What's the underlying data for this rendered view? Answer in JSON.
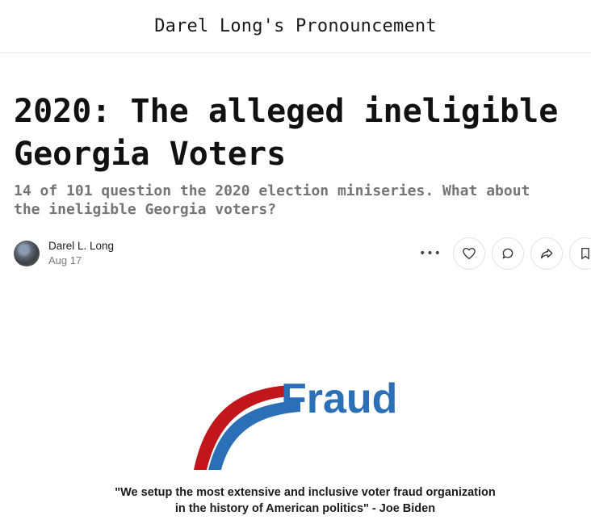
{
  "publication": {
    "title": "Darel Long's Pronouncement"
  },
  "post": {
    "title_lines": [
      "2020: The alleged ineligible",
      "Georgia Voters"
    ],
    "subtitle_lines": [
      "14 of 101 question the 2020 election miniseries. What about",
      "the ineligible Georgia voters?"
    ],
    "author": "Darel L. Long",
    "date": "Aug 17"
  },
  "actions": {
    "more_label": "•••",
    "like_icon": "heart-icon",
    "comment_icon": "comment-bubble-icon",
    "share_icon": "share-arrow-icon",
    "bookmark_icon": "bookmark-icon"
  },
  "hero_image": {
    "logo_word": "Fraud",
    "quote_lines": [
      "\"We setup the most extensive and inclusive voter fraud organization",
      "in the history of American politics\" - Joe Biden"
    ],
    "colors": {
      "red": "#c0161c",
      "blue": "#2b6fb6"
    }
  }
}
